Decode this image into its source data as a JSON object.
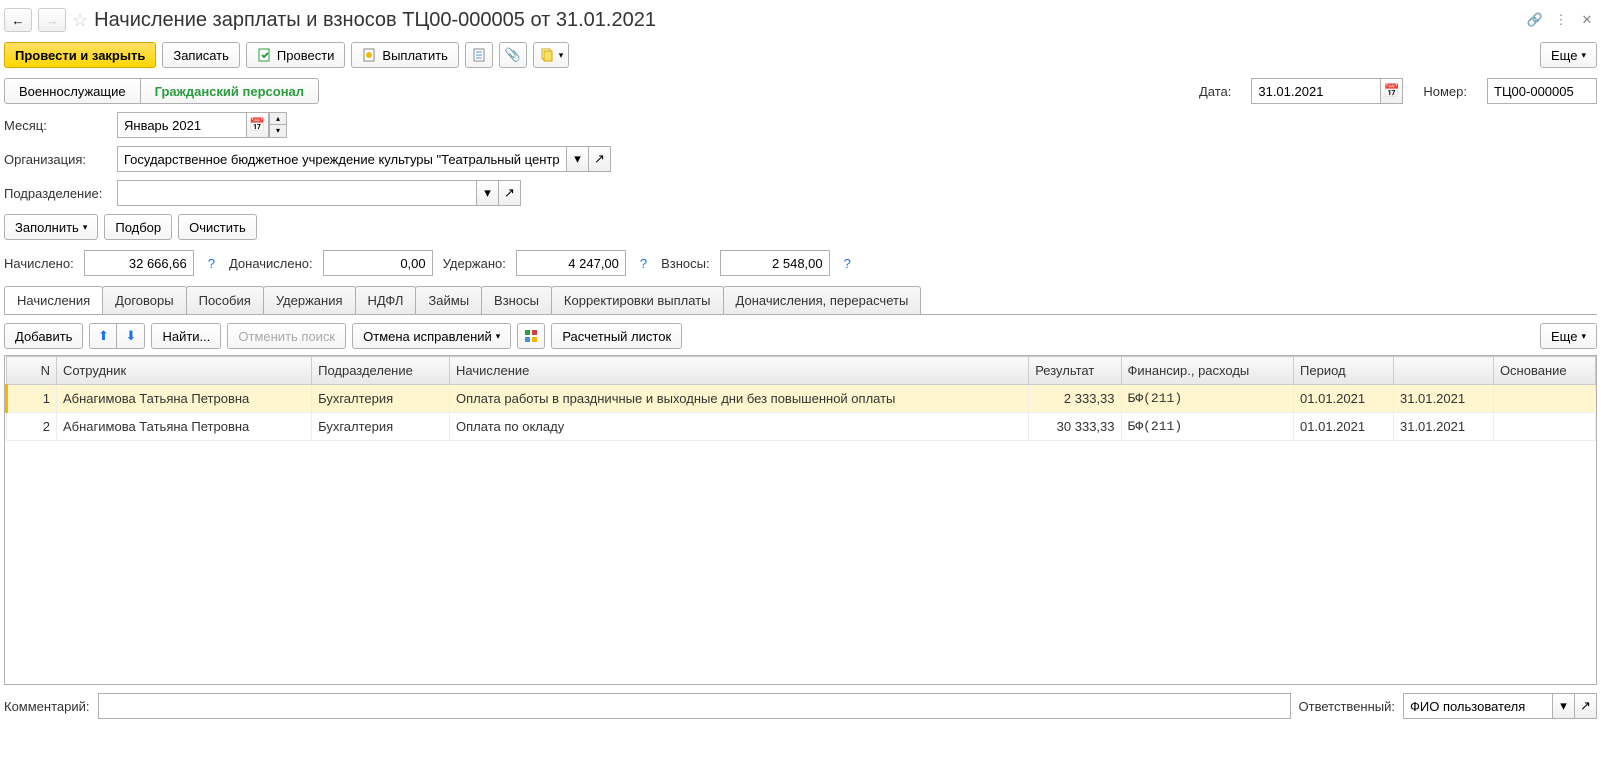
{
  "header": {
    "title": "Начисление зарплаты и взносов ТЦ00-000005 от 31.01.2021"
  },
  "toolbar": {
    "post_close": "Провести и закрыть",
    "save": "Записать",
    "post": "Провести",
    "pay": "Выплатить",
    "more": "Еще"
  },
  "segment": {
    "military": "Военнослужащие",
    "civil": "Гражданский персонал"
  },
  "date_label": "Дата:",
  "date_value": "31.01.2021",
  "number_label": "Номер:",
  "number_value": "ТЦ00-000005",
  "month_label": "Месяц:",
  "month_value": "Январь 2021",
  "org_label": "Организация:",
  "org_value": "Государственное бюджетное учреждение культуры \"Театральный центр\"",
  "dept_label": "Подразделение:",
  "dept_value": "",
  "actions": {
    "fill": "Заполнить",
    "pick": "Подбор",
    "clear": "Очистить"
  },
  "totals": {
    "accrued_label": "Начислено:",
    "accrued": "32 666,66",
    "addl_label": "Доначислено:",
    "addl": "0,00",
    "withheld_label": "Удержано:",
    "withheld": "4 247,00",
    "contrib_label": "Взносы:",
    "contrib": "2 548,00"
  },
  "tabs": [
    "Начисления",
    "Договоры",
    "Пособия",
    "Удержания",
    "НДФЛ",
    "Займы",
    "Взносы",
    "Корректировки выплаты",
    "Доначисления, перерасчеты"
  ],
  "tab_toolbar": {
    "add": "Добавить",
    "find": "Найти...",
    "cancel_search": "Отменить поиск",
    "cancel_fixes": "Отмена исправлений",
    "payslip": "Расчетный листок",
    "more": "Еще"
  },
  "table": {
    "cols": [
      "N",
      "Сотрудник",
      "Подразделение",
      "Начисление",
      "Результат",
      "Финансир., расходы",
      "Период",
      "",
      "Основание"
    ],
    "rows": [
      {
        "n": "1",
        "emp": "Абнагимова Татьяна Петровна",
        "dept": "Бухгалтерия",
        "acc": "Оплата работы в праздничные и выходные дни без повышенной оплаты",
        "res": "2 333,33",
        "fin": "БФ(211)",
        "from": "01.01.2021",
        "to": "31.01.2021",
        "base": ""
      },
      {
        "n": "2",
        "emp": "Абнагимова Татьяна Петровна",
        "dept": "Бухгалтерия",
        "acc": "Оплата по окладу",
        "res": "30 333,33",
        "fin": "БФ(211)",
        "from": "01.01.2021",
        "to": "31.01.2021",
        "base": ""
      }
    ]
  },
  "footer": {
    "comment_label": "Комментарий:",
    "comment_value": "",
    "resp_label": "Ответственный:",
    "resp_value": "ФИО пользователя"
  }
}
